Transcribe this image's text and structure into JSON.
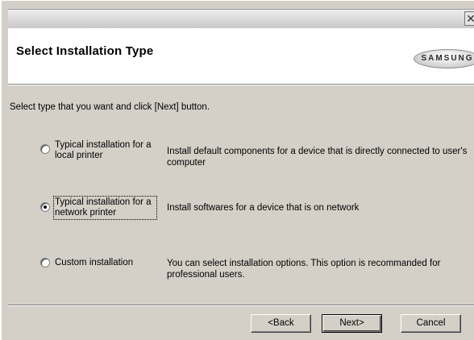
{
  "window": {
    "close_glyph": "✕"
  },
  "header": {
    "title": "Select Installation Type",
    "logo_text": "SAMSUNG"
  },
  "instruction": "Select type that you want and click [Next] button.",
  "options": [
    {
      "label": "Typical installation for a local printer",
      "description": "Install default components for a device that is directly connected to user's computer",
      "selected": false
    },
    {
      "label": "Typical installation for a network printer",
      "description": "Install softwares for a device that is on network",
      "selected": true
    },
    {
      "label": "Custom installation",
      "description": "You can select installation options. This option is recommanded for professional users.",
      "selected": false
    }
  ],
  "buttons": {
    "back": "<Back",
    "next": "Next>",
    "cancel": "Cancel"
  }
}
